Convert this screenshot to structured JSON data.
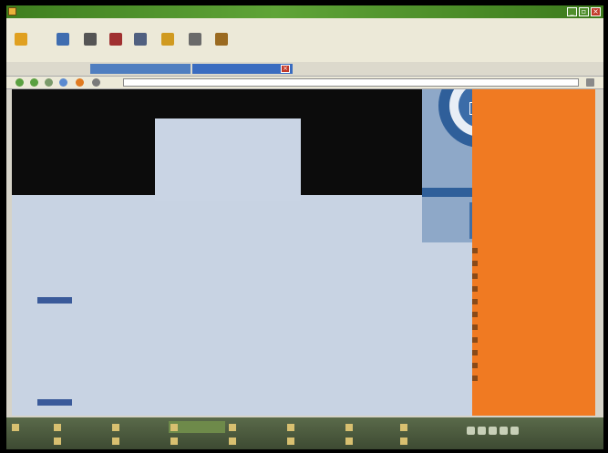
{
  "window": {
    "title": ""
  },
  "menu": [
    "",
    "",
    "",
    "",
    "",
    "",
    ""
  ],
  "toolbar": [
    {
      "icon": "sun-icon",
      "label": "",
      "color": "#e0a020"
    },
    {
      "icon": "folder-icon",
      "label": "",
      "color": "#3f6db0"
    },
    {
      "icon": "printer-icon",
      "label": "",
      "color": "#555555"
    },
    {
      "icon": "scissors-icon",
      "label": "",
      "color": "#a03030"
    },
    {
      "icon": "copy-icon",
      "label": "",
      "color": "#506080"
    },
    {
      "icon": "paste-icon",
      "label": "",
      "color": "#d09a20"
    },
    {
      "icon": "text-icon",
      "label": "",
      "color": "#6a6a6a"
    },
    {
      "icon": "palette-icon",
      "label": "",
      "color": "#9a6a20"
    }
  ],
  "tabs": [
    {
      "label": "",
      "active": false
    },
    {
      "label": "",
      "active": false
    },
    {
      "label": "",
      "active": true
    }
  ],
  "address": {
    "url": ""
  },
  "page": {
    "banner": "",
    "nav_links": [
      "",
      "",
      "",
      ""
    ],
    "sidebar_items": [
      "",
      "",
      "",
      "",
      "",
      "",
      "",
      "",
      "",
      "",
      ""
    ],
    "articles": [
      {
        "title": "",
        "byline": "",
        "body": "",
        "link": ""
      },
      {
        "title": "",
        "byline": "",
        "body": "",
        "link": ""
      }
    ]
  },
  "taskbar": {
    "tasks_row1": [
      "",
      "",
      "",
      "",
      "",
      "",
      "",
      ""
    ],
    "tasks_row2": [
      "",
      "",
      "",
      "",
      "",
      "",
      ""
    ],
    "clock": ""
  },
  "colors": {
    "accent_orange": "#f07a22",
    "content_bg": "#c8d3e3",
    "title_green": "#4f8e2c"
  }
}
